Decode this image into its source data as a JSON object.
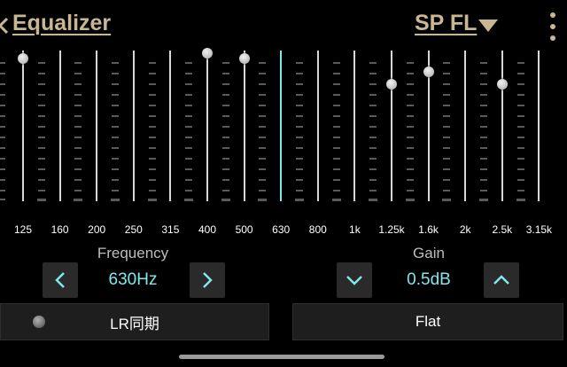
{
  "header": {
    "title": "Equalizer",
    "channel": "SP FL",
    "back_icon": "chevron-left-icon",
    "dropdown_icon": "triangle-down-icon",
    "more_icon": "vertical-dots-icon"
  },
  "colors": {
    "accent": "#7fe8ec",
    "title": "#c9b793",
    "background": "#000000"
  },
  "eq": {
    "bands": [
      {
        "freq": "125",
        "gain_level": 1.0
      },
      {
        "freq": "160",
        "gain_level": null
      },
      {
        "freq": "200",
        "gain_level": null
      },
      {
        "freq": "250",
        "gain_level": null
      },
      {
        "freq": "315",
        "gain_level": null
      },
      {
        "freq": "400",
        "gain_level": 1.04
      },
      {
        "freq": "500",
        "gain_level": 1.0
      },
      {
        "freq": "630",
        "gain_level": null,
        "selected": true
      },
      {
        "freq": "800",
        "gain_level": null
      },
      {
        "freq": "1k",
        "gain_level": null
      },
      {
        "freq": "1.25k",
        "gain_level": 0.81
      },
      {
        "freq": "1.6k",
        "gain_level": 0.9
      },
      {
        "freq": "2k",
        "gain_level": null
      },
      {
        "freq": "2.5k",
        "gain_level": 0.81
      },
      {
        "freq": "3.15k",
        "gain_level": null
      }
    ]
  },
  "frequency": {
    "label": "Frequency",
    "value": "630Hz",
    "prev_icon": "chevron-left-icon",
    "next_icon": "chevron-right-icon"
  },
  "gain": {
    "label": "Gain",
    "value": "0.5dB",
    "down_icon": "chevron-down-icon",
    "up_icon": "chevron-up-icon"
  },
  "bottom": {
    "lr_sync_label": "LR同期",
    "flat_label": "Flat"
  }
}
